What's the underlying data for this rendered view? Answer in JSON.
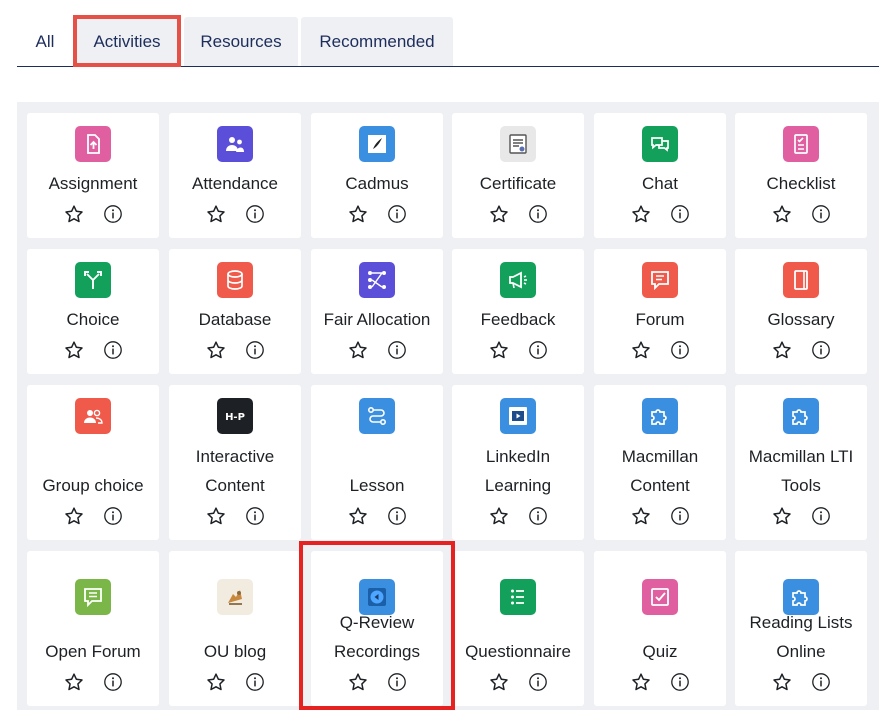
{
  "tabs": [
    {
      "label": "All"
    },
    {
      "label": "Activities"
    },
    {
      "label": "Resources"
    },
    {
      "label": "Recommended"
    }
  ],
  "items": [
    {
      "lines": [
        "Assignment"
      ],
      "icon": "assignment-icon",
      "color": "#e05fa0"
    },
    {
      "lines": [
        "Attendance"
      ],
      "icon": "attendance-icon",
      "color": "#5b4fd9"
    },
    {
      "lines": [
        "Cadmus"
      ],
      "icon": "cadmus-logo-icon",
      "color": "#3a8fe0"
    },
    {
      "lines": [
        "Certificate"
      ],
      "icon": "certificate-icon",
      "color": "#e8e8e8"
    },
    {
      "lines": [
        "Chat"
      ],
      "icon": "chat-icon",
      "color": "#12a05a"
    },
    {
      "lines": [
        "Checklist"
      ],
      "icon": "checklist-icon",
      "color": "#e05fa0"
    },
    {
      "lines": [
        "Choice"
      ],
      "icon": "choice-icon",
      "color": "#12a05a"
    },
    {
      "lines": [
        "Database"
      ],
      "icon": "database-icon",
      "color": "#ef5a4a"
    },
    {
      "lines": [
        "Fair Allocation"
      ],
      "icon": "fair-allocation-icon",
      "color": "#5b4fd9"
    },
    {
      "lines": [
        "Feedback"
      ],
      "icon": "feedback-icon",
      "color": "#12a05a"
    },
    {
      "lines": [
        "Forum"
      ],
      "icon": "forum-icon",
      "color": "#ef5a4a"
    },
    {
      "lines": [
        "Glossary"
      ],
      "icon": "glossary-icon",
      "color": "#ef5a4a"
    },
    {
      "lines": [
        "Group choice"
      ],
      "icon": "group-choice-icon",
      "color": "#ef5a4a"
    },
    {
      "lines": [
        "Interactive",
        "Content"
      ],
      "icon": "h5p-icon",
      "color": "#1d2125"
    },
    {
      "lines": [
        "Lesson"
      ],
      "icon": "lesson-icon",
      "color": "#3a8fe0"
    },
    {
      "lines": [
        "LinkedIn",
        "Learning"
      ],
      "icon": "linkedin-learning-icon",
      "color": "#3a8fe0"
    },
    {
      "lines": [
        "Macmillan",
        "Content"
      ],
      "icon": "lti-puzzle-icon",
      "color": "#3a8fe0"
    },
    {
      "lines": [
        "Macmillan LTI",
        "Tools"
      ],
      "icon": "lti-puzzle-icon",
      "color": "#3a8fe0"
    },
    {
      "lines": [
        "Open Forum"
      ],
      "icon": "open-forum-icon",
      "color": "#7ab648"
    },
    {
      "lines": [
        "OU blog"
      ],
      "icon": "ou-blog-icon",
      "color": "#f2ebe0"
    },
    {
      "lines": [
        "Q-Review",
        "Recordings"
      ],
      "icon": "q-review-icon",
      "color": "#3a8fe0"
    },
    {
      "lines": [
        "Questionnaire"
      ],
      "icon": "questionnaire-icon",
      "color": "#12a05a"
    },
    {
      "lines": [
        "Quiz"
      ],
      "icon": "quiz-icon",
      "color": "#e05fa0"
    },
    {
      "lines": [
        "Reading Lists",
        "Online"
      ],
      "icon": "lti-puzzle-icon",
      "color": "#3a8fe0"
    }
  ],
  "actions": {
    "star_icon": "star-icon",
    "info_icon": "info-icon"
  }
}
